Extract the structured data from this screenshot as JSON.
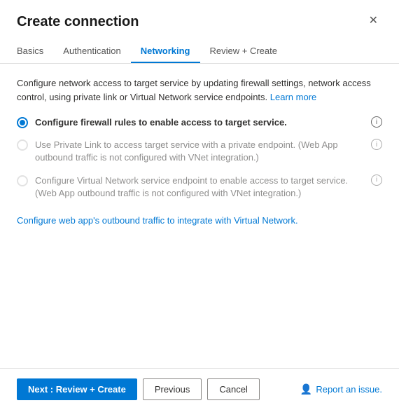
{
  "dialog": {
    "title": "Create connection",
    "close_label": "✕"
  },
  "tabs": [
    {
      "label": "Basics",
      "active": false
    },
    {
      "label": "Authentication",
      "active": false
    },
    {
      "label": "Networking",
      "active": true
    },
    {
      "label": "Review + Create",
      "active": false
    }
  ],
  "content": {
    "description": "Configure network access to target service by updating firewall settings, network access control, using private link or Virtual Network service endpoints.",
    "learn_more_label": "Learn more",
    "options": [
      {
        "id": "opt1",
        "selected": true,
        "disabled": false,
        "label": "Configure firewall rules to enable access to target service.",
        "has_info": true
      },
      {
        "id": "opt2",
        "selected": false,
        "disabled": true,
        "label": "Use Private Link to access target service with a private endpoint. (Web App outbound traffic is not configured with VNet integration.)",
        "has_info": true
      },
      {
        "id": "opt3",
        "selected": false,
        "disabled": true,
        "label": "Configure Virtual Network service endpoint to enable access to target service. (Web App outbound traffic is not configured with VNet integration.)",
        "has_info": true
      }
    ],
    "vnet_link_label": "Configure web app's outbound traffic to integrate with Virtual Network."
  },
  "footer": {
    "next_label": "Next : Review + Create",
    "previous_label": "Previous",
    "cancel_label": "Cancel",
    "report_label": "Report an issue."
  }
}
